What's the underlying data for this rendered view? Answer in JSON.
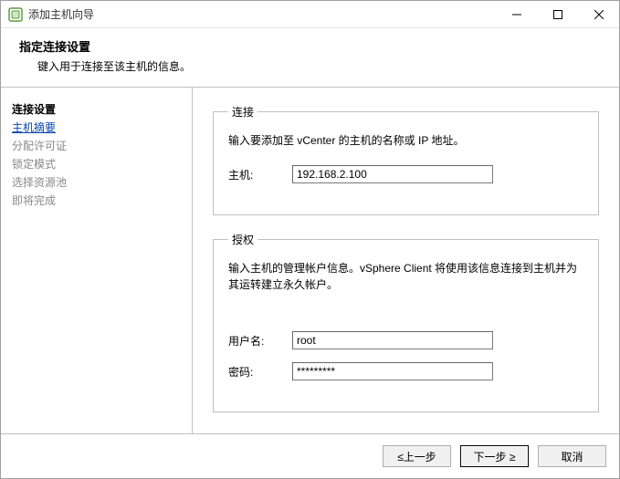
{
  "window": {
    "title": "添加主机向导"
  },
  "header": {
    "title": "指定连接设置",
    "desc": "键入用于连接至该主机的信息。"
  },
  "sidebar": {
    "items": [
      {
        "label": "连接设置"
      },
      {
        "label": "主机摘要"
      },
      {
        "label": "分配许可证"
      },
      {
        "label": "锁定模式"
      },
      {
        "label": "选择资源池"
      },
      {
        "label": "即将完成"
      }
    ]
  },
  "connection": {
    "legend": "连接",
    "help": "输入要添加至 vCenter 的主机的名称或 IP 地址。",
    "host_label": "主机:",
    "host_value": "192.168.2.100"
  },
  "auth": {
    "legend": "授权",
    "help": "输入主机的管理帐户信息。vSphere Client 将使用该信息连接到主机并为其运转建立永久帐户。",
    "user_label": "用户名:",
    "user_value": "root",
    "pass_label": "密码:",
    "pass_value": "*********"
  },
  "footer": {
    "back": "≤上一步",
    "next": "下一步 ≥",
    "cancel": "取消"
  }
}
